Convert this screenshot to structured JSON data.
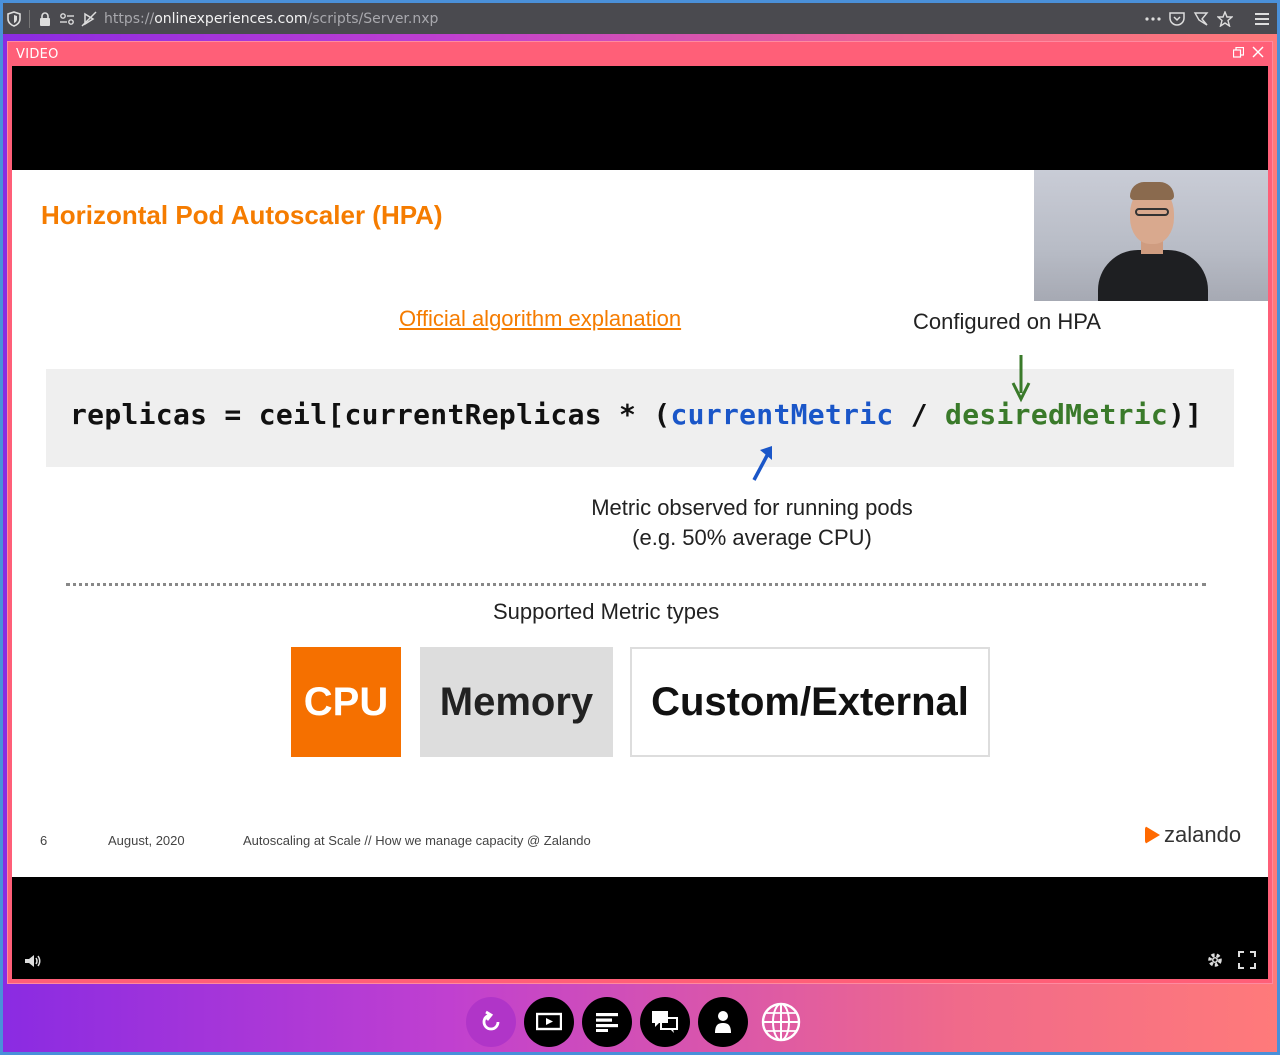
{
  "browser": {
    "url_scheme": "https://",
    "url_host": "onlinexperiences.com",
    "url_path": "/scripts/Server.nxp"
  },
  "video_panel": {
    "title": "VIDEO"
  },
  "slide": {
    "title": "Horizontal Pod Autoscaler (HPA)",
    "link": "Official algorithm explanation",
    "configured_label": "Configured on HPA",
    "formula": {
      "part1": "replicas = ceil[currentReplicas * (",
      "current_metric": "currentMetric",
      "divider": " / ",
      "desired_metric": "desiredMetric",
      "part2": ")]"
    },
    "observed_line1": "Metric observed for running pods",
    "observed_line2": "(e.g. 50% average CPU)",
    "supported_heading": "Supported Metric types",
    "metrics": [
      "CPU",
      "Memory",
      "Custom/External"
    ],
    "footer": {
      "page": "6",
      "date": "August, 2020",
      "description": "Autoscaling at Scale // How we manage capacity @ Zalando"
    },
    "brand": "zalando",
    "colors": {
      "orange": "#f57c00",
      "blue": "#1a56c8",
      "green": "#3a7a2a"
    }
  },
  "toolbar": {
    "buttons": [
      "refresh-icon",
      "screen-icon",
      "agenda-icon",
      "chat-icon",
      "profile-icon",
      "globe-icon"
    ]
  }
}
